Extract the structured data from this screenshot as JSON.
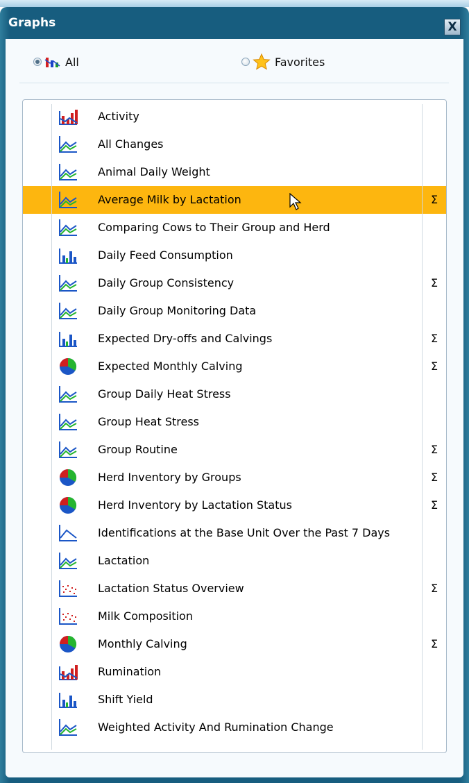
{
  "window": {
    "title": "Graphs",
    "close_label": "X"
  },
  "filters": {
    "all_label": "All",
    "favorites_label": "Favorites",
    "selected": "all"
  },
  "list": {
    "items": [
      {
        "label": "Activity",
        "icon": "bar-activity-icon",
        "sigma": ""
      },
      {
        "label": "All Changes",
        "icon": "line-graph-icon",
        "sigma": ""
      },
      {
        "label": "Animal Daily Weight",
        "icon": "line-graph-icon",
        "sigma": ""
      },
      {
        "label": "Average Milk by Lactation",
        "icon": "line-graph-icon",
        "sigma": "Σ"
      },
      {
        "label": "Comparing Cows to Their Group and Herd",
        "icon": "line-graph-icon",
        "sigma": ""
      },
      {
        "label": "Daily Feed Consumption",
        "icon": "bar-blue-icon",
        "sigma": ""
      },
      {
        "label": "Daily Group Consistency",
        "icon": "line-graph-icon",
        "sigma": "Σ"
      },
      {
        "label": "Daily Group Monitoring Data",
        "icon": "line-graph-icon",
        "sigma": ""
      },
      {
        "label": "Expected Dry-offs and Calvings",
        "icon": "bar-blue-icon",
        "sigma": "Σ"
      },
      {
        "label": "Expected Monthly Calving",
        "icon": "pie-chart-icon",
        "sigma": "Σ"
      },
      {
        "label": "Group Daily Heat Stress",
        "icon": "line-graph-icon",
        "sigma": ""
      },
      {
        "label": "Group Heat Stress",
        "icon": "line-graph-icon",
        "sigma": ""
      },
      {
        "label": "Group Routine",
        "icon": "line-graph-icon",
        "sigma": "Σ"
      },
      {
        "label": "Herd Inventory by Groups",
        "icon": "pie-chart-icon",
        "sigma": "Σ"
      },
      {
        "label": "Herd Inventory by Lactation Status",
        "icon": "pie-chart-icon",
        "sigma": "Σ"
      },
      {
        "label": "Identifications at the Base Unit Over the Past 7 Days",
        "icon": "single-line-icon",
        "sigma": ""
      },
      {
        "label": "Lactation",
        "icon": "line-graph-icon",
        "sigma": ""
      },
      {
        "label": "Lactation Status Overview",
        "icon": "scatter-icon",
        "sigma": "Σ"
      },
      {
        "label": "Milk Composition",
        "icon": "scatter-icon",
        "sigma": ""
      },
      {
        "label": "Monthly Calving",
        "icon": "pie-chart-icon",
        "sigma": "Σ"
      },
      {
        "label": "Rumination",
        "icon": "bar-activity-icon",
        "sigma": ""
      },
      {
        "label": "Shift Yield",
        "icon": "bar-blue-icon",
        "sigma": ""
      },
      {
        "label": "Weighted Activity And Rumination Change",
        "icon": "line-graph-icon",
        "sigma": ""
      }
    ],
    "selected_index": 3
  },
  "colors": {
    "title_bar": "#175d7f",
    "selection": "#fdb60f"
  }
}
